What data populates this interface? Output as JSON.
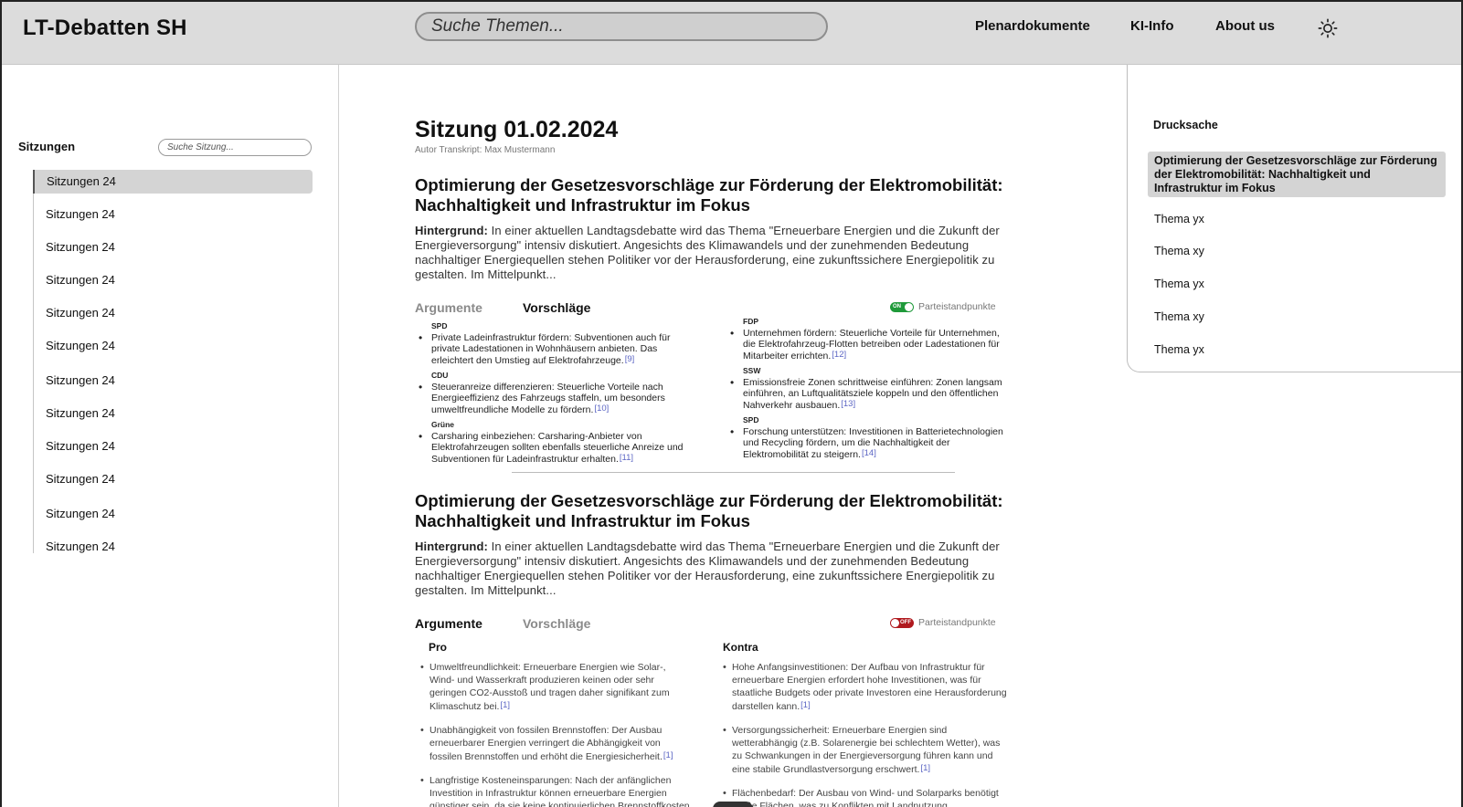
{
  "header": {
    "brand": "LT-Debatten SH",
    "search_placeholder": "Suche Themen...",
    "nav": [
      "Plenardokumente",
      "KI-Info",
      "About us"
    ],
    "theme_icon": "sun-icon"
  },
  "sidebar": {
    "title": "Sitzungen",
    "search_placeholder": "Suche Sitzung...",
    "items": [
      "Sitzungen 24",
      "Sitzungen 24",
      "Sitzungen 24",
      "Sitzungen 24",
      "Sitzungen 24",
      "Sitzungen 24",
      "Sitzungen 24",
      "Sitzungen 24",
      "Sitzungen 24",
      "Sitzungen 24",
      "Sitzungen 24",
      "Sitzungen 24"
    ]
  },
  "main": {
    "title": "Sitzung 01.02.2024",
    "author": "Autor Transkript: Max Mustermann",
    "topics": [
      {
        "title": "Optimierung der Gesetzesvorschläge zur Förderung der Elektromobilität: Nachhaltigkeit und Infrastruktur im Fokus",
        "bg_label": "Hintergrund:",
        "bg_text": "In einer aktuellen Landtagsdebatte wird das Thema \"Erneuerbare Energien und die Zukunft der Energieversorgung\" intensiv diskutiert. Angesichts des Klimawandels und der zunehmenden Bedeutung nachhaltiger Energiequellen stehen Politiker vor der Herausforderung, eine zukunftssichere Energiepolitik zu gestalten. Im Mittelpunkt...",
        "tab_args": "Argumente",
        "tab_props": "Vorschläge",
        "toggle_text": "ON",
        "toggle_label": "Parteistandpunkte",
        "left_props": [
          {
            "party": "SPD",
            "text": "Private Ladeinfrastruktur fördern: Subventionen auch für private Ladestationen in Wohnhäusern anbieten. Das erleichtert den Umstieg auf Elektrofahrzeuge.",
            "ref": "[9]"
          },
          {
            "party": "CDU",
            "text": "Steueranreize differenzieren: Steuerliche Vorteile nach Energieeffizienz des Fahrzeugs staffeln, um besonders umweltfreundliche Modelle zu fördern.",
            "ref": "[10]"
          },
          {
            "party": "Grüne",
            "text": "Carsharing einbeziehen: Carsharing-Anbieter von Elektrofahrzeugen sollten ebenfalls steuerliche Anreize und Subventionen für Ladeinfrastruktur erhalten.",
            "ref": "[11]"
          }
        ],
        "right_props": [
          {
            "party": "FDP",
            "text": "Unternehmen fördern: Steuerliche Vorteile für Unternehmen, die Elektrofahrzeug-Flotten betreiben oder Ladestationen für Mitarbeiter errichten.",
            "ref": "[12]"
          },
          {
            "party": "SSW",
            "text": "Emissionsfreie Zonen schrittweise einführen: Zonen langsam einführen, an Luftqualitätsziele koppeln und den öffentlichen Nahverkehr ausbauen.",
            "ref": "[13]"
          },
          {
            "party": "SPD",
            "text": "Forschung unterstützen: Investitionen in Batterietechnologien und Recycling fördern, um die Nachhaltigkeit der Elektromobilität zu steigern.",
            "ref": "[14]"
          }
        ]
      },
      {
        "title": "Optimierung der Gesetzesvorschläge zur Förderung der Elektromobilität: Nachhaltigkeit und Infrastruktur im Fokus",
        "bg_label": "Hintergrund:",
        "bg_text": "In einer aktuellen Landtagsdebatte wird das Thema \"Erneuerbare Energien und die Zukunft der Energieversorgung\" intensiv diskutiert. Angesichts des Klimawandels und der zunehmenden Bedeutung nachhaltiger Energiequellen stehen Politiker vor der Herausforderung, eine zukunftssichere Energiepolitik zu gestalten. Im Mittelpunkt...",
        "tab_args": "Argumente",
        "tab_props": "Vorschläge",
        "toggle_text": "OFF",
        "toggle_label": "Parteistandpunkte",
        "pro_title": "Pro",
        "contra_title": "Kontra",
        "pro": [
          {
            "text": "Umweltfreundlichkeit: Erneuerbare Energien wie Solar-, Wind- und Wasserkraft produzieren keinen oder sehr geringen CO2-Ausstoß und tragen daher signifikant zum Klimaschutz bei.",
            "ref": "[1]"
          },
          {
            "text": "Unabhängigkeit von fossilen Brennstoffen: Der Ausbau erneuerbarer Energien verringert die Abhängigkeit von fossilen Brennstoffen und erhöht die Energiesicherheit.",
            "ref": "[1]"
          },
          {
            "text": "Langfristige Kosteneinsparungen: Nach der anfänglichen Investition in Infrastruktur können erneuerbare Energien günstiger sein, da sie keine kontinuierlichen Brennstoffkosten",
            "ref": ""
          }
        ],
        "contra": [
          {
            "text": "Hohe Anfangsinvestitionen: Der Aufbau von Infrastruktur für erneuerbare Energien erfordert hohe Investitionen, was für staatliche Budgets oder private Investoren eine Herausforderung darstellen kann.",
            "ref": "[1]"
          },
          {
            "text": "Versorgungssicherheit: Erneuerbare Energien sind wetterabhängig (z.B. Solarenergie bei schlechtem Wetter), was zu Schwankungen in der Energieversorgung führen kann und eine stabile Grundlastversorgung erschwert.",
            "ref": "[1]"
          },
          {
            "text": "Flächenbedarf: Der Ausbau von Wind- und Solarparks benötigt große Flächen, was zu Konflikten mit Landnutzung",
            "ref": ""
          }
        ]
      }
    ]
  },
  "drucksache": {
    "title": "Drucksache",
    "items": [
      "Optimierung der Gesetzesvorschläge zur Förderung der Elektromobilität: Nachhaltigkeit und Infrastruktur im Fokus",
      "Thema yx",
      "Thema xy",
      "Thema yx",
      "Thema xy",
      "Thema yx"
    ]
  },
  "colors": {
    "header_bg": "#dcdcdc",
    "active_bg": "#d4d4d4",
    "toggle_on": "#1f9a3a",
    "toggle_off": "#b0191e",
    "ref_link": "#5c66c4"
  }
}
